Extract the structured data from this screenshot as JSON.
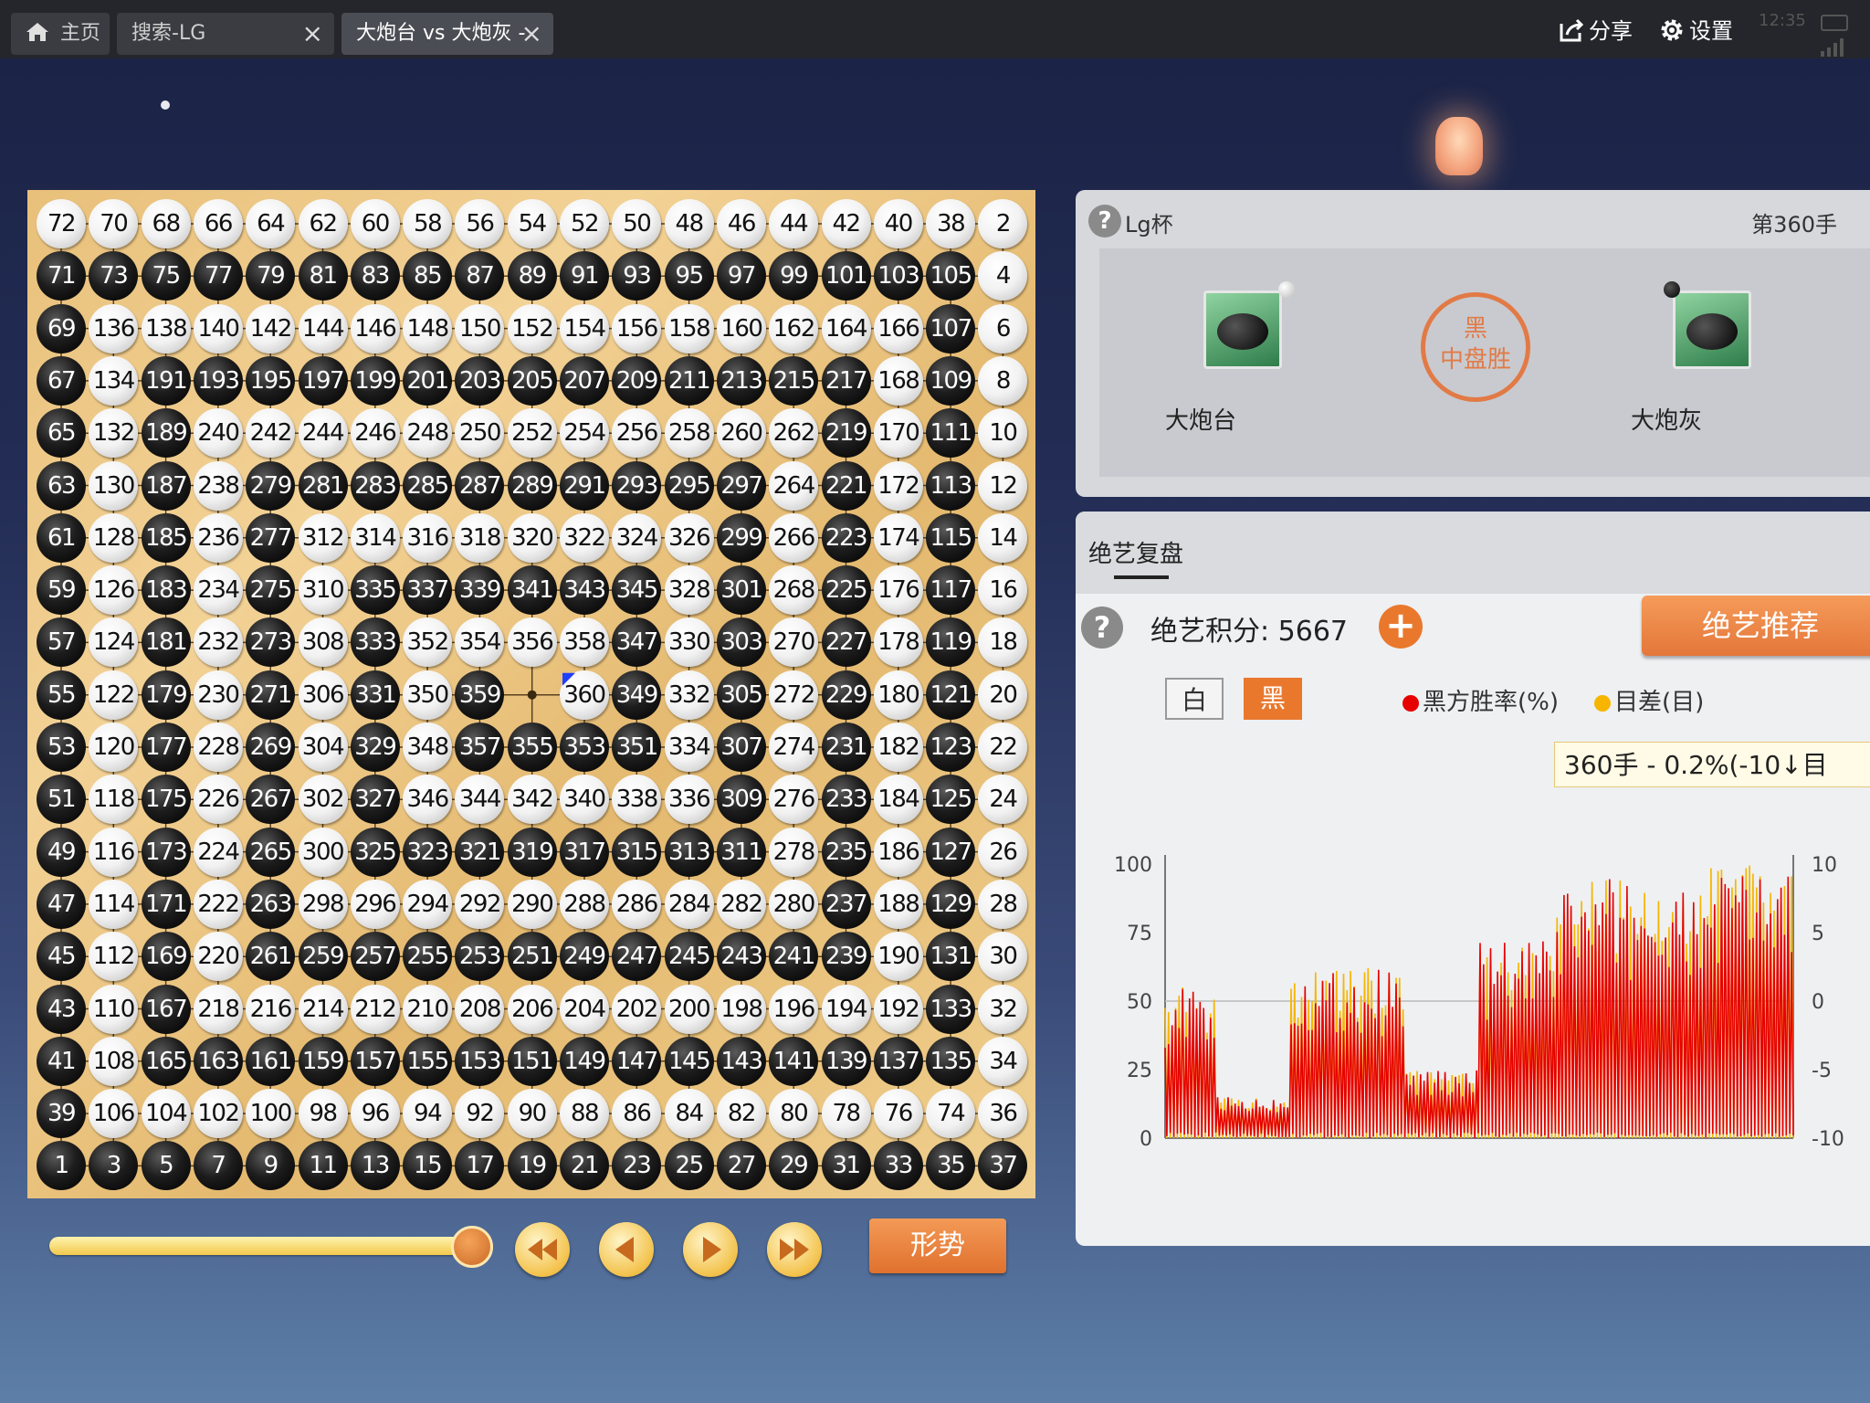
{
  "tabs": [
    {
      "label": "主页",
      "icon": "home-icon"
    },
    {
      "label": "搜索-LG",
      "close": "×"
    },
    {
      "label": "大炮台 vs 大炮灰 -",
      "close": "×"
    }
  ],
  "toolbar": {
    "share_label": "分享",
    "settings_label": "设置"
  },
  "status": {
    "time": "12:35"
  },
  "board": {
    "size": 19,
    "tenuki_marker": "blue-triangle",
    "rows": [
      [
        "72w",
        "70w",
        "68w",
        "66w",
        "64w",
        "62w",
        "60w",
        "58w",
        "56w",
        "54w",
        "52w",
        "50w",
        "48w",
        "46w",
        "44w",
        "42w",
        "40w",
        "38w",
        "2w"
      ],
      [
        "71b",
        "73b",
        "75b",
        "77b",
        "79b",
        "81b",
        "83b",
        "85b",
        "87b",
        "89b",
        "91b",
        "93b",
        "95b",
        "97b",
        "99b",
        "101b",
        "103b",
        "105b",
        "4w"
      ],
      [
        "69b",
        "136w",
        "138w",
        "140w",
        "142w",
        "144w",
        "146w",
        "148w",
        "150w",
        "152w",
        "154w",
        "156w",
        "158w",
        "160w",
        "162w",
        "164w",
        "166w",
        "107b",
        "6w"
      ],
      [
        "67b",
        "134w",
        "191b",
        "193b",
        "195b",
        "197b",
        "199b",
        "201b",
        "203b",
        "205b",
        "207b",
        "209b",
        "211b",
        "213b",
        "215b",
        "217b",
        "168w",
        "109b",
        "8w"
      ],
      [
        "65b",
        "132w",
        "189b",
        "240w",
        "242w",
        "244w",
        "246w",
        "248w",
        "250w",
        "252w",
        "254w",
        "256w",
        "258w",
        "260w",
        "262w",
        "219b",
        "170w",
        "111b",
        "10w"
      ],
      [
        "63b",
        "130w",
        "187b",
        "238w",
        "279b",
        "281b",
        "283b",
        "285b",
        "287b",
        "289b",
        "291b",
        "293b",
        "295b",
        "297b",
        "264w",
        "221b",
        "172w",
        "113b",
        "12w"
      ],
      [
        "61b",
        "128w",
        "185b",
        "236w",
        "277b",
        "312w",
        "314w",
        "316w",
        "318w",
        "320w",
        "322w",
        "324w",
        "326w",
        "299b",
        "266w",
        "223b",
        "174w",
        "115b",
        "14w"
      ],
      [
        "59b",
        "126w",
        "183b",
        "234w",
        "275b",
        "310w",
        "335b",
        "337b",
        "339b",
        "341b",
        "343b",
        "345b",
        "328w",
        "301b",
        "268w",
        "225b",
        "176w",
        "117b",
        "16w"
      ],
      [
        "57b",
        "124w",
        "181b",
        "232w",
        "273b",
        "308w",
        "333b",
        "352w",
        "354w",
        "356w",
        "358w",
        "347b",
        "330w",
        "303b",
        "270w",
        "227b",
        "178w",
        "119b",
        "18w"
      ],
      [
        "55b",
        "122w",
        "179b",
        "230w",
        "271b",
        "306w",
        "331b",
        "350w",
        "359b",
        "",
        "360w",
        "349b",
        "332w",
        "305b",
        "272w",
        "229b",
        "180w",
        "121b",
        "20w"
      ],
      [
        "53b",
        "120w",
        "177b",
        "228w",
        "269b",
        "304w",
        "329b",
        "348w",
        "357b",
        "355b",
        "353b",
        "351b",
        "334w",
        "307b",
        "274w",
        "231b",
        "182w",
        "123b",
        "22w"
      ],
      [
        "51b",
        "118w",
        "175b",
        "226w",
        "267b",
        "302w",
        "327b",
        "346w",
        "344w",
        "342w",
        "340w",
        "338w",
        "336w",
        "309b",
        "276w",
        "233b",
        "184w",
        "125b",
        "24w"
      ],
      [
        "49b",
        "116w",
        "173b",
        "224w",
        "265b",
        "300w",
        "325b",
        "323b",
        "321b",
        "319b",
        "317b",
        "315b",
        "313b",
        "311b",
        "278w",
        "235b",
        "186w",
        "127b",
        "26w"
      ],
      [
        "47b",
        "114w",
        "171b",
        "222w",
        "263b",
        "298w",
        "296w",
        "294w",
        "292w",
        "290w",
        "288w",
        "286w",
        "284w",
        "282w",
        "280w",
        "237b",
        "188w",
        "129b",
        "28w"
      ],
      [
        "45b",
        "112w",
        "169b",
        "220w",
        "261b",
        "259b",
        "257b",
        "255b",
        "253b",
        "251b",
        "249b",
        "247b",
        "245b",
        "243b",
        "241b",
        "239b",
        "190w",
        "131b",
        "30w"
      ],
      [
        "43b",
        "110w",
        "167b",
        "218w",
        "216w",
        "214w",
        "212w",
        "210w",
        "208w",
        "206w",
        "204w",
        "202w",
        "200w",
        "198w",
        "196w",
        "194w",
        "192w",
        "133b",
        "32w"
      ],
      [
        "41b",
        "108w",
        "165b",
        "163b",
        "161b",
        "159b",
        "157b",
        "155b",
        "153b",
        "151b",
        "149b",
        "147b",
        "145b",
        "143b",
        "141b",
        "139b",
        "137b",
        "135b",
        "34w"
      ],
      [
        "39b",
        "106w",
        "104w",
        "102w",
        "100w",
        "98w",
        "96w",
        "94w",
        "92w",
        "90w",
        "88w",
        "86w",
        "84w",
        "82w",
        "80w",
        "78w",
        "76w",
        "74w",
        "36w"
      ],
      [
        "1b",
        "3b",
        "5b",
        "7b",
        "9b",
        "11b",
        "13b",
        "15b",
        "17b",
        "19b",
        "21b",
        "23b",
        "25b",
        "27b",
        "29b",
        "31b",
        "33b",
        "35b",
        "37b"
      ]
    ]
  },
  "controls": {
    "progress": 1.0,
    "trend_label": "形势"
  },
  "game": {
    "cup": "Lg杯",
    "move": "第360手",
    "player_white": "大炮台",
    "player_black": "大炮灰",
    "result_line1": "黑",
    "result_line2": "中盘胜"
  },
  "review": {
    "tab_label": "绝艺复盘",
    "score": "绝艺积分: 5667",
    "plus": "+",
    "recommend_label": "绝艺推荐",
    "btn_white": "白",
    "btn_black": "黑",
    "legend_winrate": "黑方胜率(%)",
    "legend_diff": "目差(目)",
    "tooltip": "360手 - 0.2%(-10↓目",
    "colors": {
      "winrate": "#e60000",
      "diff": "#f7b500",
      "accent": "#e9782d"
    }
  },
  "chart_data": {
    "type": "line",
    "x_range": [
      1,
      360
    ],
    "y_left_ticks": [
      "100",
      "75",
      "50",
      "25",
      "0"
    ],
    "y_right_ticks": [
      "10",
      "5",
      "0",
      "-5",
      "-10"
    ],
    "ylim_left": [
      0,
      100
    ],
    "ylim_right": [
      -10,
      10
    ],
    "grid": "midline",
    "series": [
      {
        "name": "黑方胜率(%)",
        "color": "#e60000",
        "values": []
      },
      {
        "name": "目差(目)",
        "color": "#f7b500",
        "values": []
      }
    ]
  }
}
